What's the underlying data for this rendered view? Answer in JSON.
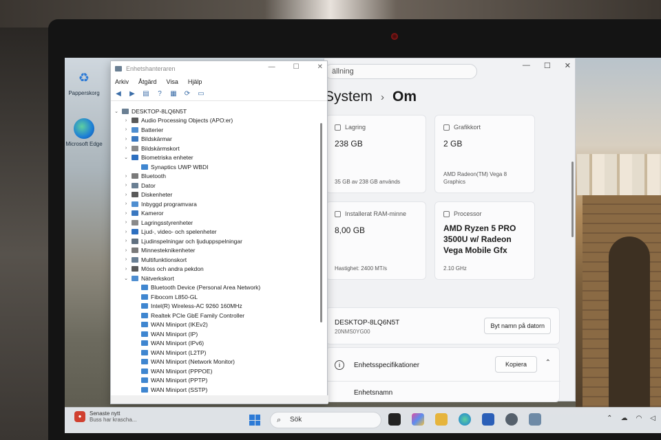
{
  "desktop": {
    "icons": [
      {
        "label": "Papperskorg"
      },
      {
        "label": "Microsoft Edge"
      }
    ]
  },
  "device_manager": {
    "title": "Enhetshanteraren",
    "menu": [
      "Arkiv",
      "Åtgärd",
      "Visa",
      "Hjälp"
    ],
    "tree": [
      {
        "label": "DESKTOP-8LQ6N5T",
        "level": 0,
        "expanded": true
      },
      {
        "label": "Audio Processing Objects (APO:er)",
        "level": 1,
        "expanded": false
      },
      {
        "label": "Batterier",
        "level": 1,
        "expanded": false
      },
      {
        "label": "Bildskärmar",
        "level": 1,
        "expanded": false
      },
      {
        "label": "Bildskärmskort",
        "level": 1,
        "expanded": false
      },
      {
        "label": "Biometriska enheter",
        "level": 1,
        "expanded": true
      },
      {
        "label": "Synaptics UWP WBDI",
        "level": 2
      },
      {
        "label": "Bluetooth",
        "level": 1,
        "expanded": false
      },
      {
        "label": "Dator",
        "level": 1,
        "expanded": false
      },
      {
        "label": "Diskenheter",
        "level": 1,
        "expanded": false
      },
      {
        "label": "Inbyggd programvara",
        "level": 1,
        "expanded": false
      },
      {
        "label": "Kameror",
        "level": 1,
        "expanded": false
      },
      {
        "label": "Lagringsstyrenheter",
        "level": 1,
        "expanded": false
      },
      {
        "label": "Ljud-, video- och spelenheter",
        "level": 1,
        "expanded": false
      },
      {
        "label": "Ljudinspelningar och ljuduppspelningar",
        "level": 1,
        "expanded": false
      },
      {
        "label": "Minnesteknikenheter",
        "level": 1,
        "expanded": false
      },
      {
        "label": "Multifunktionskort",
        "level": 1,
        "expanded": false
      },
      {
        "label": "Möss och andra pekdon",
        "level": 1,
        "expanded": false
      },
      {
        "label": "Nätverkskort",
        "level": 1,
        "expanded": true
      },
      {
        "label": "Bluetooth Device (Personal Area Network)",
        "level": 2
      },
      {
        "label": "Fibocom L850-GL",
        "level": 2
      },
      {
        "label": "Intel(R) Wireless-AC 9260 160MHz",
        "level": 2
      },
      {
        "label": "Realtek PCIe GbE Family Controller",
        "level": 2
      },
      {
        "label": "WAN Miniport (IKEv2)",
        "level": 2
      },
      {
        "label": "WAN Miniport (IP)",
        "level": 2
      },
      {
        "label": "WAN Miniport (IPv6)",
        "level": 2
      },
      {
        "label": "WAN Miniport (L2TP)",
        "level": 2
      },
      {
        "label": "WAN Miniport (Network Monitor)",
        "level": 2
      },
      {
        "label": "WAN Miniport (PPPOE)",
        "level": 2
      },
      {
        "label": "WAN Miniport (PPTP)",
        "level": 2
      },
      {
        "label": "WAN Miniport (SSTP)",
        "level": 2
      }
    ]
  },
  "settings": {
    "search_text": "ällning",
    "breadcrumb": {
      "parent": "System",
      "separator": "›",
      "current": "Om"
    },
    "cards": {
      "storage": {
        "label": "Lagring",
        "value": "238 GB",
        "detail": "35 GB av 238 GB används"
      },
      "graphics": {
        "label": "Grafikkort",
        "value": "2 GB",
        "detail": "AMD Radeon(TM) Vega 8 Graphics"
      },
      "ram": {
        "label": "Installerat RAM-minne",
        "value": "8,00 GB",
        "detail": "Hastighet: 2400 MT/s"
      },
      "processor": {
        "label": "Processor",
        "value": "AMD Ryzen 5 PRO 3500U w/ Radeon Vega Mobile Gfx",
        "detail": "2.10 GHz"
      }
    },
    "device": {
      "name": "DESKTOP-8LQ6N5T",
      "model": "20NMS0YG00",
      "rename_button": "Byt namn på datorn"
    },
    "specs": {
      "title": "Enhetsspecifikationer",
      "copy_button": "Kopiera",
      "first_row_label": "Enhetsnamn"
    }
  },
  "taskbar": {
    "news_title": "Senaste nytt",
    "news_subtitle": "Buss har krascha...",
    "search_label": "Sök"
  }
}
